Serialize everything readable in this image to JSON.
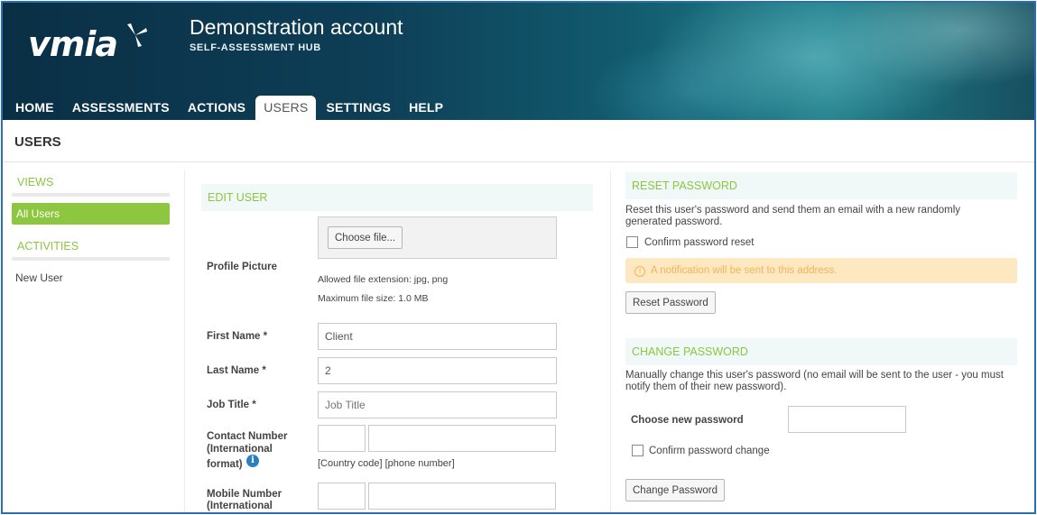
{
  "header": {
    "logo": "vmia",
    "account_title": "Demonstration account",
    "account_subtitle": "SELF-ASSESSMENT HUB"
  },
  "nav": {
    "items": [
      {
        "label": "HOME"
      },
      {
        "label": "ASSESSMENTS"
      },
      {
        "label": "ACTIONS"
      },
      {
        "label": "USERS",
        "active": true
      },
      {
        "label": "SETTINGS"
      },
      {
        "label": "HELP"
      }
    ]
  },
  "page": {
    "title": "USERS"
  },
  "sidebar": {
    "views_heading": "VIEWS",
    "views_active": "All Users",
    "activities_heading": "ACTIVITIES",
    "activities_link": "New User"
  },
  "edit_user": {
    "heading": "EDIT USER",
    "profile_picture_label": "Profile Picture",
    "choose_file_label": "Choose file...",
    "allowed_ext": "Allowed file extension: jpg, png",
    "max_size": "Maximum file size: 1.0 MB",
    "first_name_label": "First Name *",
    "first_name_value": "Client",
    "last_name_label": "Last Name *",
    "last_name_value": "2",
    "job_title_label": "Job Title *",
    "job_title_placeholder": "Job Title",
    "contact_label_line1": "Contact Number",
    "contact_label_line2": "(International",
    "contact_label_line3": "format)",
    "contact_hint": "[Country code] [phone number]",
    "mobile_label_line1": "Mobile Number",
    "mobile_label_line2": "(International"
  },
  "reset_password": {
    "heading": "RESET PASSWORD",
    "description": "Reset this user's password and send them an email with a new randomly generated password.",
    "confirm_label": "Confirm password reset",
    "notice": "A notification will be sent to this address.",
    "button_label": "Reset Password"
  },
  "change_password": {
    "heading": "CHANGE PASSWORD",
    "description": "Manually change this user's password (no email will be sent to the user - you must notify them of their new password).",
    "new_password_label": "Choose new password",
    "confirm_label": "Confirm password change",
    "button_label": "Change Password"
  },
  "colors": {
    "accent_green": "#8dc63f",
    "frame_blue": "#2a6fb3",
    "notice_bg": "#fde8c2"
  },
  "icons": {
    "info": "info-icon",
    "warning": "warning-icon"
  }
}
